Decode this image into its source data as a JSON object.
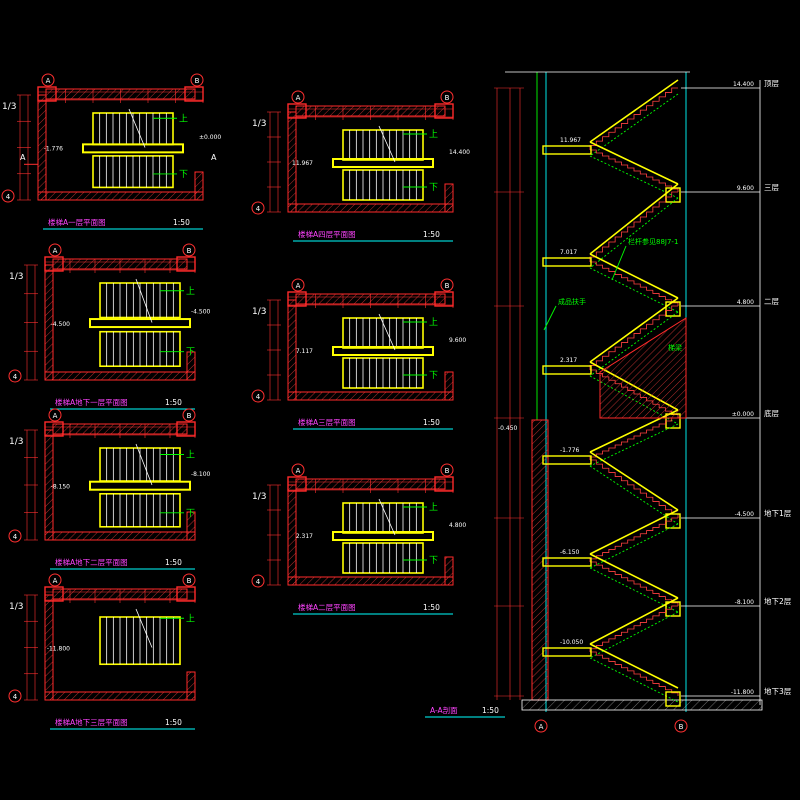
{
  "colors": {
    "background": "#000000",
    "wall": "#ff2a2a",
    "stair": "#ffff00",
    "dim": "#ff3030",
    "cyan": "#00ffff",
    "green": "#00ff00",
    "white": "#ffffff",
    "title": "#ff44ff"
  },
  "plans": [
    {
      "id": "plan-1f",
      "title": "楼梯A一层平面图",
      "scale": "1:50",
      "axes": [
        "A",
        "B",
        "1/3",
        "4"
      ],
      "levels": [
        "-1.776",
        "±0.000"
      ],
      "arrows": [
        "上",
        "下"
      ],
      "section_marks": [
        "A",
        "A"
      ]
    },
    {
      "id": "plan-b1",
      "title": "楼梯A地下一层平面图",
      "scale": "1:50",
      "axes": [
        "A",
        "B",
        "1/3",
        "4"
      ],
      "levels": [
        "-4.500",
        "-4.500"
      ],
      "arrows": [
        "上",
        "下"
      ]
    },
    {
      "id": "plan-b2",
      "title": "楼梯A地下二层平面图",
      "scale": "1:50",
      "axes": [
        "A",
        "B",
        "1/3",
        "4"
      ],
      "levels": [
        "-8.150",
        "-8.100"
      ],
      "arrows": [
        "上",
        "下"
      ]
    },
    {
      "id": "plan-b3",
      "title": "楼梯A地下三层平面图",
      "scale": "1:50",
      "axes": [
        "A",
        "B",
        "1/3",
        "4"
      ],
      "levels": [
        "-11.800"
      ],
      "arrows": [
        "上"
      ]
    },
    {
      "id": "plan-4f",
      "title": "楼梯A四层平面图",
      "scale": "1:50",
      "axes": [
        "A",
        "B",
        "1/3",
        "4"
      ],
      "levels": [
        "11.967",
        "14.400"
      ],
      "arrows": [
        "上",
        "下"
      ]
    },
    {
      "id": "plan-3f",
      "title": "楼梯A三层平面图",
      "scale": "1:50",
      "axes": [
        "A",
        "B",
        "1/3",
        "4"
      ],
      "levels": [
        "7.117",
        "9.600"
      ],
      "arrows": [
        "上",
        "下"
      ]
    },
    {
      "id": "plan-2f",
      "title": "楼梯A二层平面图",
      "scale": "1:50",
      "axes": [
        "A",
        "B",
        "1/3",
        "4"
      ],
      "levels": [
        "2.317",
        "4.800"
      ],
      "arrows": [
        "上",
        "下"
      ]
    }
  ],
  "section": {
    "title": "A-A剖面",
    "scale": "1:50",
    "axes": [
      "A",
      "B"
    ],
    "floors": [
      {
        "label": "顶层",
        "elevation": "14.400"
      },
      {
        "label": "三层",
        "elevation": "9.600"
      },
      {
        "label": "二层",
        "elevation": "4.800"
      },
      {
        "label": "底层",
        "elevation": "±0.000"
      },
      {
        "label": "地下1层",
        "elevation": "-4.500"
      },
      {
        "label": "地下2层",
        "elevation": "-8.100"
      },
      {
        "label": "地下3层",
        "elevation": "-11.800"
      }
    ],
    "landings": [
      "11.967",
      "7.017",
      "2.317",
      "-1.776",
      "-6.150",
      "-10.050"
    ],
    "side_level": "-0.450",
    "notes": [
      "栏杆参见88J7-1",
      "成品扶手",
      "梯梁"
    ]
  }
}
